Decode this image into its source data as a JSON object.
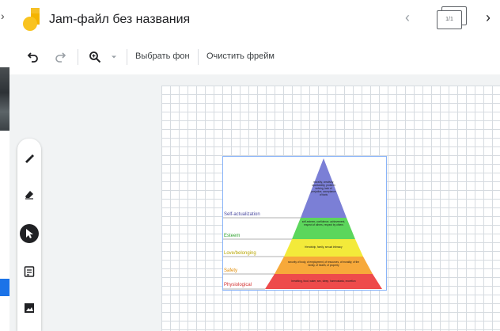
{
  "app": {
    "title": "Jam-файл без названия",
    "frame_counter": "1/1"
  },
  "toolbar": {
    "background_label": "Выбрать фон",
    "clear_label": "Очистить фрейм"
  },
  "pyramid": {
    "labels": [
      {
        "text": "Self-actualization",
        "color": "#4a4aa0"
      },
      {
        "text": "Esteem",
        "color": "#2ea02e"
      },
      {
        "text": "Love/belonging",
        "color": "#b8a600"
      },
      {
        "text": "Safety",
        "color": "#e08a00"
      },
      {
        "text": "Physiological",
        "color": "#d32f2f"
      }
    ],
    "levels": [
      {
        "text": "morality, creativity, spontaneity, problem solving, lack of prejudice, acceptance of facts",
        "color": "#7b7fd6"
      },
      {
        "text": "self-esteem, confidence, achievement, respect of others, respect by others",
        "color": "#5cd65c"
      },
      {
        "text": "friendship, family, sexual intimacy",
        "color": "#f3ea3a"
      },
      {
        "text": "security of body, of employment, of resources, of morality, of the family, of health, of property",
        "color": "#f7a93a"
      },
      {
        "text": "breathing, food, water, sex, sleep, homeostasis, excretion",
        "color": "#ee4b4b"
      }
    ]
  }
}
